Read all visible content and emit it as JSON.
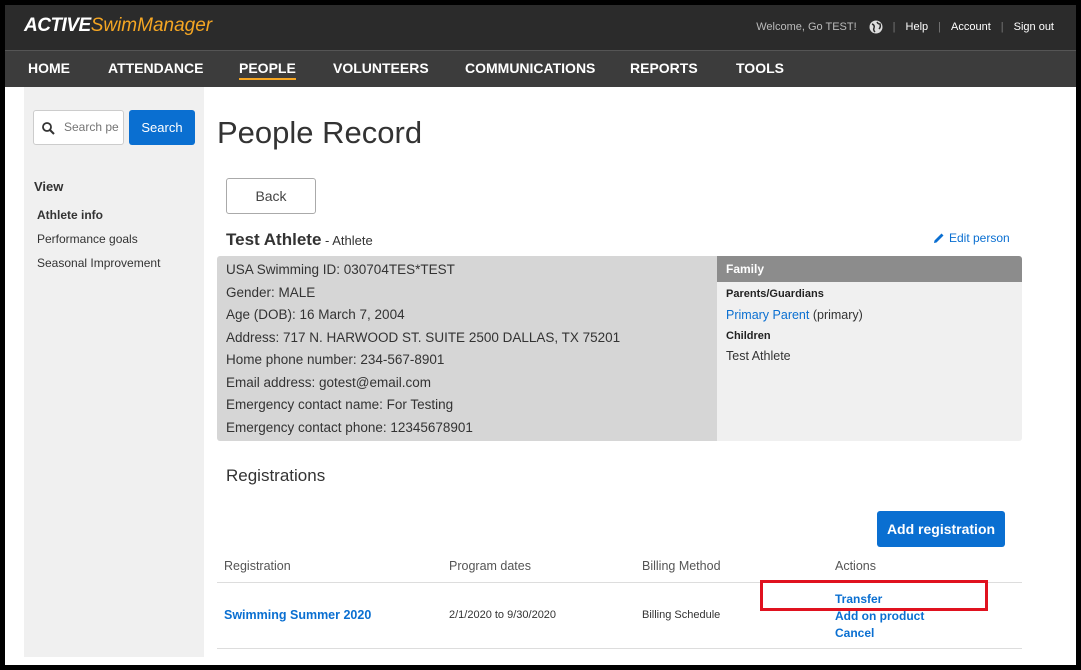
{
  "app": {
    "logo_active": "ACTIVE",
    "logo_swim": "SwimManager",
    "welcome": "Welcome, Go TEST!",
    "help": "Help",
    "account": "Account",
    "signout": "Sign out"
  },
  "nav": {
    "home": "HOME",
    "attendance": "ATTENDANCE",
    "people": "PEOPLE",
    "volunteers": "VOLUNTEERS",
    "communications": "COMMUNICATIONS",
    "reports": "REPORTS",
    "tools": "TOOLS",
    "active_item": "PEOPLE"
  },
  "sidebar": {
    "search_placeholder": "Search people",
    "search_button": "Search",
    "view_title": "View",
    "links": [
      "Athlete info",
      "Performance goals",
      "Seasonal Improvement"
    ]
  },
  "page": {
    "title": "People Record",
    "back": "Back",
    "athlete_name": "Test Athlete",
    "athlete_role": " - Athlete",
    "edit_person": "Edit person"
  },
  "info": {
    "lines": [
      "USA Swimming ID: 030704TES*TEST",
      "Gender: MALE",
      "Age (DOB): 16 March 7, 2004",
      "Address: 717 N. HARWOOD ST. SUITE 2500 DALLAS, TX 75201",
      "Home phone number: 234-567-8901",
      "Email address: gotest@email.com",
      "Emergency contact name: For Testing",
      "Emergency contact phone: 12345678901"
    ]
  },
  "family": {
    "header": "Family",
    "parents_label": "Parents/Guardians",
    "parent_link": "Primary Parent",
    "parent_suffix": " (primary)",
    "children_label": "Children",
    "child": "Test Athlete"
  },
  "registrations": {
    "title": "Registrations",
    "add_button": "Add registration",
    "headers": [
      "Registration",
      "Program dates",
      "Billing Method",
      "Actions"
    ],
    "rows": [
      {
        "name": "Swimming Summer 2020",
        "dates": "2/1/2020 to 9/30/2020",
        "billing": "Billing Schedule",
        "actions": [
          "Transfer",
          "Add on product",
          "Cancel"
        ]
      }
    ]
  },
  "colors": {
    "accent": "#0a6fd1",
    "brand_orange": "#f5a623",
    "highlight": "#e0121f"
  }
}
